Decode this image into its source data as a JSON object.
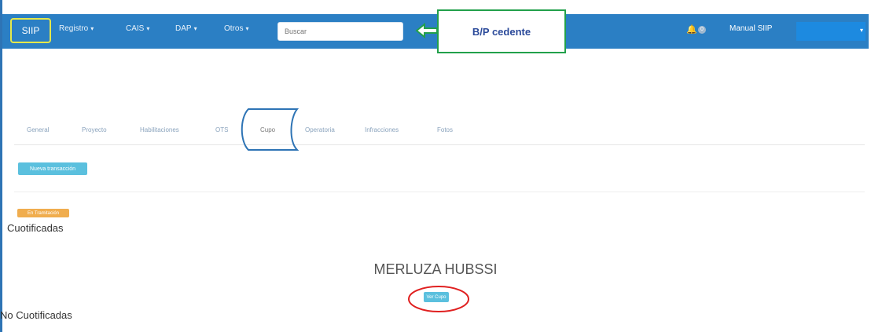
{
  "navbar": {
    "brand": "SIIP",
    "menus": [
      {
        "label": "Registro"
      },
      {
        "label": "CAIS"
      },
      {
        "label": "DAP"
      },
      {
        "label": "Otros"
      }
    ],
    "search_placeholder": "Buscar",
    "notifications_count": "0",
    "manual_label": "Manual SIIP",
    "colors": {
      "navbar_bg": "#2b7fc4",
      "brand_highlight": "#e5e84a"
    }
  },
  "callout": {
    "text": "B/P cedente",
    "color": "#22a04b"
  },
  "tabs": [
    {
      "label": "General"
    },
    {
      "label": "Proyecto"
    },
    {
      "label": "Habilitaciones"
    },
    {
      "label": "OTS"
    },
    {
      "label": "Cupo"
    },
    {
      "label": "Operatoria"
    },
    {
      "label": "Infracciones"
    },
    {
      "label": "Fotos"
    }
  ],
  "actions": {
    "nueva_label": "Nueva transacción"
  },
  "status_badge": "En Tramitación",
  "sections": {
    "cuotificadas": "Cuotificadas",
    "species": "MERLUZA HUBSSI",
    "ver_cupo": "Ver Cupo",
    "no_cuotificadas": "No Cuotificadas"
  }
}
